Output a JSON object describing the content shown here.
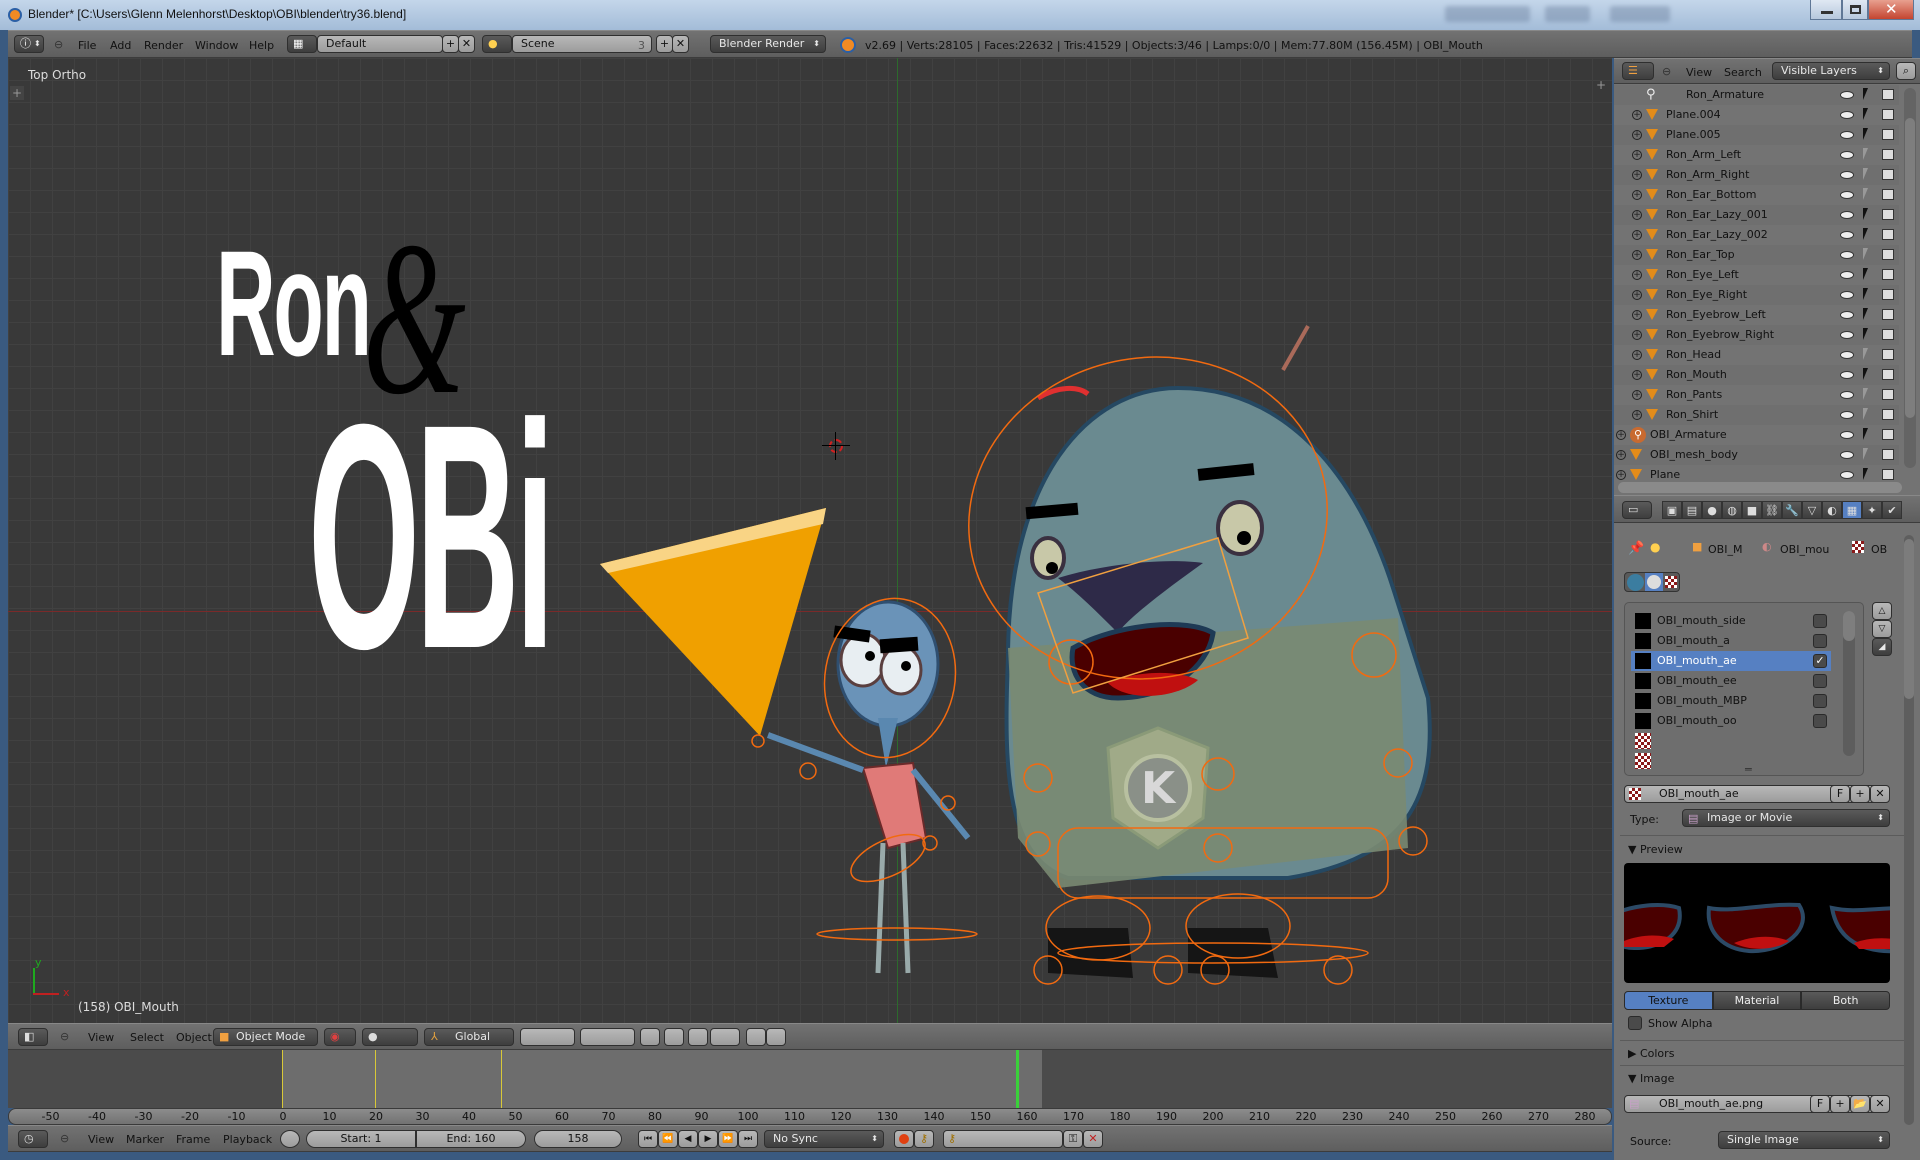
{
  "window": {
    "title": "Blender* [C:\\Users\\Glenn Melenhorst\\Desktop\\OBI\\blender\\try36.blend]"
  },
  "info_header": {
    "menus": [
      "File",
      "Add",
      "Render",
      "Window",
      "Help"
    ],
    "screen_layout": "Default",
    "scene": "Scene",
    "scene_users": "3",
    "render_engine": "Blender Render",
    "stats": "v2.69 | Verts:28105 | Faces:22632 | Tris:41529 | Objects:3/46 | Lamps:0/0 | Mem:77.80M (156.45M) | OBI_Mouth"
  },
  "viewport": {
    "view_name": "Top Ortho",
    "active_object_label": "(158) OBI_Mouth",
    "axis_x": "x",
    "axis_y": "y",
    "title_art": {
      "line1": "Ron",
      "ampersand": "&",
      "line2": "OBi"
    },
    "badge_letter": "K",
    "colors": {
      "orange_shape": "#f0a000",
      "selection": "#f26a10",
      "x_axis": "#a02020",
      "y_axis": "#1e8a1e"
    }
  },
  "view3d_header": {
    "menus": [
      "View",
      "Select",
      "Object"
    ],
    "mode": "Object Mode",
    "transform_orientation": "Global"
  },
  "timeline": {
    "ruler_ticks": [
      "-50",
      "-40",
      "-30",
      "-20",
      "-10",
      "0",
      "10",
      "20",
      "30",
      "40",
      "50",
      "60",
      "70",
      "80",
      "90",
      "100",
      "110",
      "120",
      "130",
      "140",
      "150",
      "160",
      "170",
      "180",
      "190",
      "200",
      "210",
      "220",
      "230",
      "240",
      "250",
      "260",
      "270",
      "280"
    ],
    "keyframe_markers": [
      0,
      20,
      47
    ],
    "current_frame_value": 158,
    "menus": [
      "View",
      "Marker",
      "Frame",
      "Playback"
    ],
    "start_label": "Start: 1",
    "end_label": "End: 160",
    "current_frame": "158",
    "sync": "No Sync"
  },
  "outliner": {
    "menus": [
      "View",
      "Search"
    ],
    "display_mode": "Visible Layers",
    "items": [
      {
        "name": "Ron_Armature",
        "type": "armature-child",
        "indent": 2,
        "expandable": false,
        "selectable": true
      },
      {
        "name": "Plane.004",
        "type": "mesh",
        "indent": 1,
        "selectable": true
      },
      {
        "name": "Plane.005",
        "type": "mesh",
        "indent": 1,
        "selectable": true
      },
      {
        "name": "Ron_Arm_Left",
        "type": "mesh",
        "indent": 1,
        "selectable": false
      },
      {
        "name": "Ron_Arm_Right",
        "type": "mesh",
        "indent": 1,
        "selectable": false
      },
      {
        "name": "Ron_Ear_Bottom",
        "type": "mesh",
        "indent": 1,
        "selectable": false
      },
      {
        "name": "Ron_Ear_Lazy_001",
        "type": "mesh",
        "indent": 1,
        "selectable": true
      },
      {
        "name": "Ron_Ear_Lazy_002",
        "type": "mesh",
        "indent": 1,
        "selectable": true
      },
      {
        "name": "Ron_Ear_Top",
        "type": "mesh",
        "indent": 1,
        "selectable": false
      },
      {
        "name": "Ron_Eye_Left",
        "type": "mesh",
        "indent": 1,
        "selectable": true
      },
      {
        "name": "Ron_Eye_Right",
        "type": "mesh",
        "indent": 1,
        "selectable": true
      },
      {
        "name": "Ron_Eyebrow_Left",
        "type": "mesh",
        "indent": 1,
        "selectable": true
      },
      {
        "name": "Ron_Eyebrow_Right",
        "type": "mesh",
        "indent": 1,
        "selectable": true
      },
      {
        "name": "Ron_Head",
        "type": "mesh",
        "indent": 1,
        "selectable": false
      },
      {
        "name": "Ron_Mouth",
        "type": "mesh",
        "indent": 1,
        "selectable": true
      },
      {
        "name": "Ron_Pants",
        "type": "mesh",
        "indent": 1,
        "selectable": false
      },
      {
        "name": "Ron_Shirt",
        "type": "mesh",
        "indent": 1,
        "selectable": false
      },
      {
        "name": "OBI_Armature",
        "type": "armature",
        "indent": 0,
        "selectable": true
      },
      {
        "name": "OBI_mesh_body",
        "type": "mesh",
        "indent": 0,
        "selectable": false
      },
      {
        "name": "Plane",
        "type": "mesh",
        "indent": 0,
        "selectable": true
      }
    ]
  },
  "properties": {
    "breadcrumb": [
      "OBI_M",
      "OBI_mou",
      "OB"
    ],
    "texture_slots": [
      {
        "name": "OBI_mouth_side",
        "enabled": false,
        "selected": false
      },
      {
        "name": "OBI_mouth_a",
        "enabled": false,
        "selected": false
      },
      {
        "name": "OBI_mouth_ae",
        "enabled": true,
        "selected": true
      },
      {
        "name": "OBI_mouth_ee",
        "enabled": false,
        "selected": false
      },
      {
        "name": "OBI_mouth_MBP",
        "enabled": false,
        "selected": false
      },
      {
        "name": "OBI_mouth_oo",
        "enabled": false,
        "selected": false
      },
      {
        "name": "",
        "enabled": null,
        "selected": false
      },
      {
        "name": "",
        "enabled": null,
        "selected": false
      }
    ],
    "texture_name": "OBI_mouth_ae",
    "fake_user": "F",
    "type_label": "Type:",
    "type_value": "Image or Movie",
    "preview_panel": "Preview",
    "preview_tabs": [
      "Texture",
      "Material",
      "Both"
    ],
    "preview_active_tab": "Texture",
    "show_alpha": "Show Alpha",
    "colors_panel": "Colors",
    "image_panel": "Image",
    "image_file": "OBI_mouth_ae.png",
    "source_label": "Source:",
    "source_value": "Single Image"
  }
}
